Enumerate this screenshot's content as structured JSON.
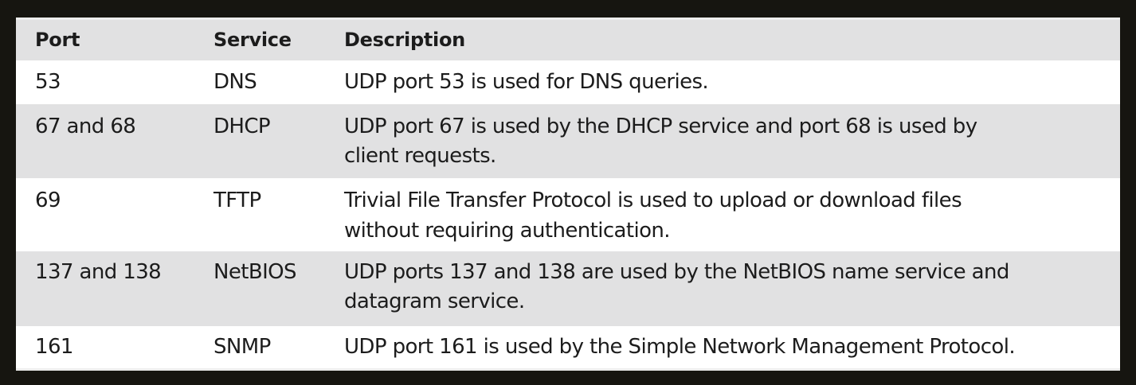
{
  "table": {
    "headers": {
      "port": "Port",
      "service": "Service",
      "description": "Description"
    },
    "rows": [
      {
        "port": "53",
        "service": "DNS",
        "description_lines": [
          "UDP port 53 is used for DNS queries."
        ]
      },
      {
        "port": "67 and 68",
        "service": "DHCP",
        "description_lines": [
          "UDP port 67 is used by the DHCP service and port 68 is used by",
          "client requests."
        ]
      },
      {
        "port": "69",
        "service": "TFTP",
        "description_lines": [
          "Trivial File Transfer Protocol is used to upload or download files",
          "without requiring authentication."
        ]
      },
      {
        "port": "137 and 138",
        "service": "NetBIOS",
        "description_lines": [
          "UDP ports 137 and 138 are used by the NetBIOS name service and",
          "datagram service."
        ]
      },
      {
        "port": "161",
        "service": "SNMP",
        "description_lines": [
          "UDP port 161 is used by the Simple Network Management Protocol."
        ]
      }
    ]
  },
  "colors": {
    "background": "#161510",
    "header_row": "#e1e1e2",
    "shaded_row": "#e1e1e2",
    "white_row": "#ffffff",
    "text": "#1c1c1c"
  }
}
